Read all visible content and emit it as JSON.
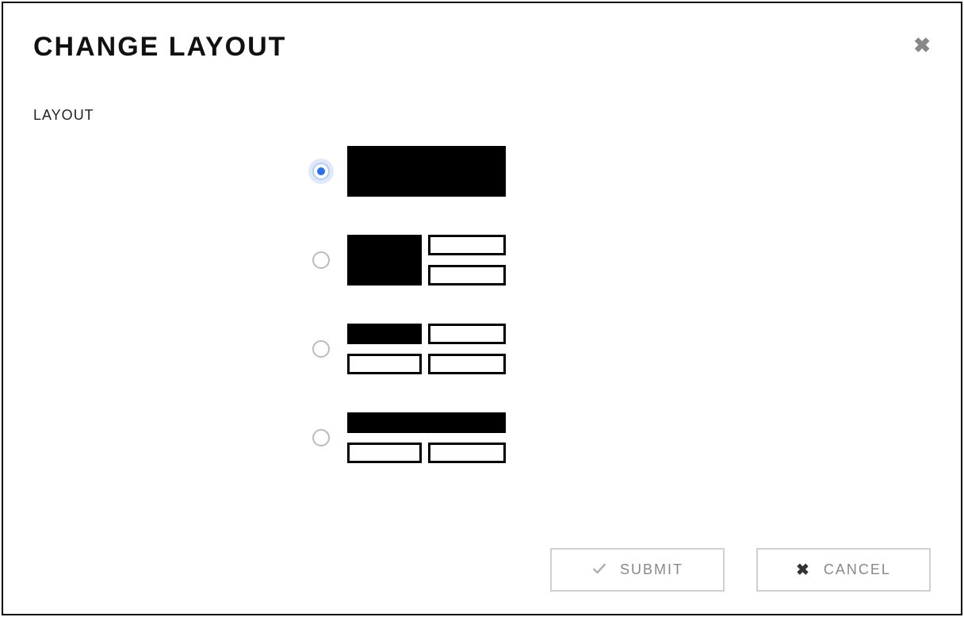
{
  "dialog": {
    "title": "CHANGE LAYOUT",
    "form_label": "LAYOUT",
    "options": [
      {
        "id": "full",
        "selected": true
      },
      {
        "id": "split-left-stack",
        "selected": false
      },
      {
        "id": "quad",
        "selected": false
      },
      {
        "id": "top-two-bottom",
        "selected": false
      }
    ],
    "buttons": {
      "submit": "SUBMIT",
      "cancel": "CANCEL"
    }
  }
}
